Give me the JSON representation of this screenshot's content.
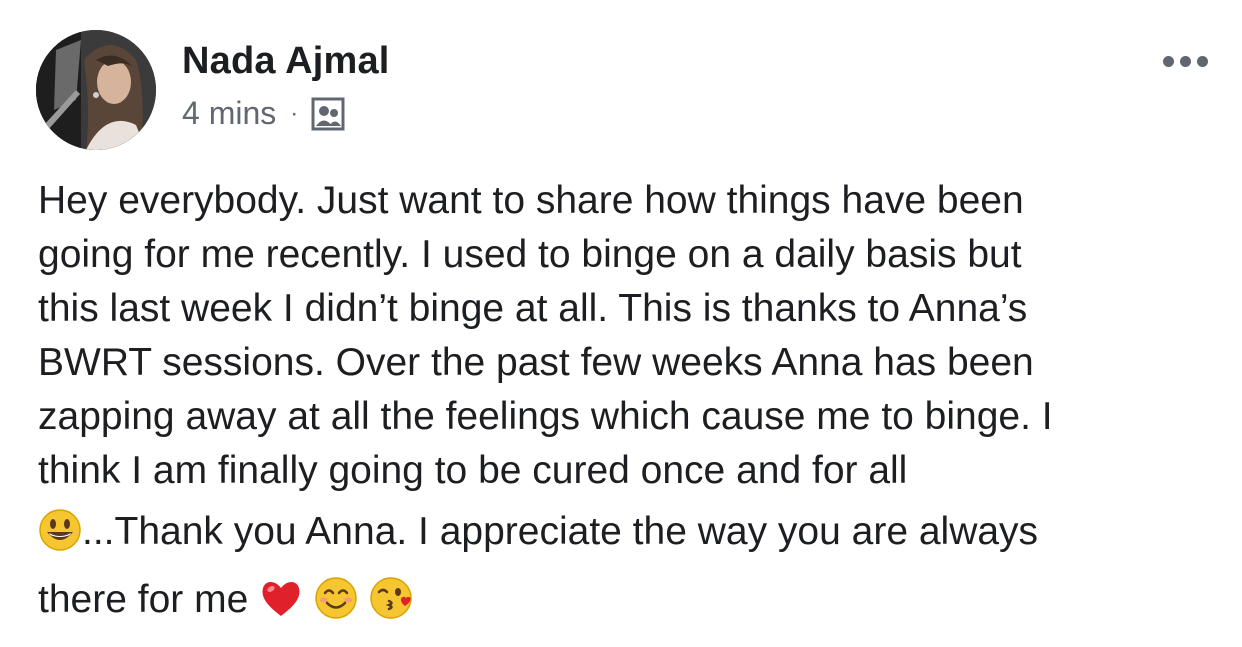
{
  "post": {
    "author": "Nada Ajmal",
    "timestamp": "4 mins",
    "separator": "·",
    "audience_icon": "friends-icon",
    "more_icon": "more-options-icon",
    "body_lines": [
      "Hey everybody. Just want to share how things have been",
      "going for me recently. I used to binge on a daily basis but",
      "this last week I didn’t binge at all. This is thanks to Anna’s",
      "BWRT sessions. Over the past few weeks Anna has been",
      "zapping away at all the feelings which cause me to binge. I",
      "think I am finally going to be cured once and for all"
    ],
    "line7_text": "...Thank you Anna. I appreciate the way you are always",
    "line8_text": "there for me",
    "emojis": [
      "grinning-face-emoji",
      "red-heart-emoji",
      "smiling-face-emoji",
      "face-blowing-kiss-emoji"
    ]
  }
}
